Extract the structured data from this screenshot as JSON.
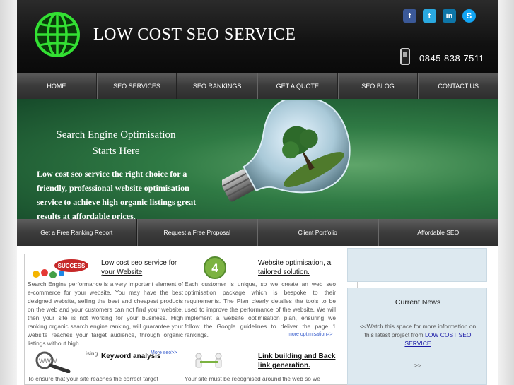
{
  "header": {
    "title": "LOW COST SEO SERVICE",
    "phone": "0845 838 7511",
    "socials": [
      {
        "name": "facebook-icon",
        "glyph": "f",
        "color": "#3b5998"
      },
      {
        "name": "twitter-icon",
        "glyph": "t",
        "color": "#2aa9e0"
      },
      {
        "name": "linkedin-icon",
        "glyph": "in",
        "color": "#0e76a8"
      },
      {
        "name": "skype-icon",
        "glyph": "S",
        "color": "#12a5f4"
      }
    ]
  },
  "nav": {
    "items": [
      "HOME",
      "SEO SERVICES",
      "SEO RANKINGS",
      "GET A QUOTE",
      "SEO BLOG",
      "CONTACT US"
    ]
  },
  "hero": {
    "title_line1": "Search Engine Optimisation",
    "title_line2": "Starts Here",
    "text": "Low cost seo service the right choice for a friendly, professional website optimisation service to achieve high organic listings great results at affordable prices."
  },
  "subnav": {
    "items": [
      "Get a Free Ranking Report",
      "Request a Free Proposal",
      "Client Portfolio",
      "Affordable SEO"
    ]
  },
  "blocks": {
    "b1": {
      "title": "Low cost seo service for your Website",
      "icon_text": "SUCCESS",
      "text": "Search Engine performance is a very important element of e-commerce for your website.  You may have the best designed website, selling the best and cheapest products on the web and your customers can not find your website, then your site is not working for your business. High ranking organic search engine ranking, will guarantee your website reaches your target audience, through organic listings without high",
      "text_tail": "ising.",
      "more": "More seo>>"
    },
    "b2": {
      "title": "Website optimisation, a tailored solution.",
      "icon_text": "4",
      "text": "Each customer is unique, so we create an web seo optimisation package which is bespoke to their requirements. The Plan clearly detailes the tools to be used to improve the performance of the website. We will implement a website optimisation plan, ensuring we follow the Google guidelines to deliver the page 1 rankings.",
      "more": "more optimisation>>"
    },
    "b3": {
      "title": "Keyword analysis",
      "icon_text": "WWW",
      "text": "To ensure that your site reaches the correct target"
    },
    "b4": {
      "title": "Link building and Back link generation.",
      "text": "Your site must be recognised around the web so we"
    }
  },
  "sidebar": {
    "news_title": "Current News",
    "news_text_before": "<<Watch this space for more information on this latest project from ",
    "news_link": "LOW COST SEO SERVICE",
    "news_more": ">>"
  }
}
